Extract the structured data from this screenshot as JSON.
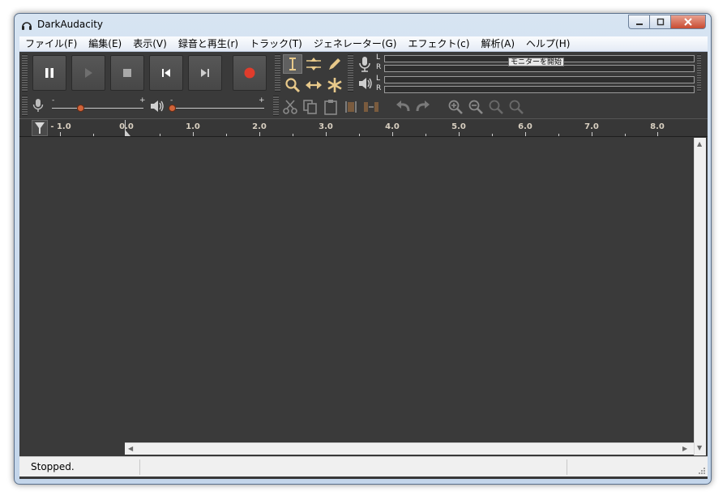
{
  "window": {
    "title": "DarkAudacity",
    "icon": "headphones-icon"
  },
  "menubar": {
    "items": [
      "ファイル(F)",
      "編集(E)",
      "表示(V)",
      "録音と再生(r)",
      "トラック(T)",
      "ジェネレーター(G)",
      "エフェクト(c)",
      "解析(A)",
      "ヘルプ(H)"
    ]
  },
  "transport": {
    "buttons": [
      "pause",
      "play",
      "stop",
      "skip-to-start",
      "skip-to-end",
      "record"
    ],
    "record_color": "#e03c2c"
  },
  "tools": [
    "selection-tool",
    "envelope-tool",
    "draw-tool",
    "zoom-tool",
    "time-shift-tool",
    "multi-tool"
  ],
  "meters": {
    "record_channels": [
      "L",
      "R"
    ],
    "playback_channels": [
      "L",
      "R"
    ],
    "monitor_label": "モニターを開始"
  },
  "mixer": {
    "minus": "-",
    "plus": "+"
  },
  "ruler": {
    "labels": [
      "- 1.0",
      "0.0",
      "1.0",
      "2.0",
      "3.0",
      "4.0",
      "5.0",
      "6.0",
      "7.0",
      "8.0"
    ]
  },
  "status": {
    "text": "Stopped."
  },
  "colors": {
    "accent_orange": "#d0643a",
    "ruler_text": "#d8cfc0",
    "background_dark": "#3a3a3a"
  }
}
